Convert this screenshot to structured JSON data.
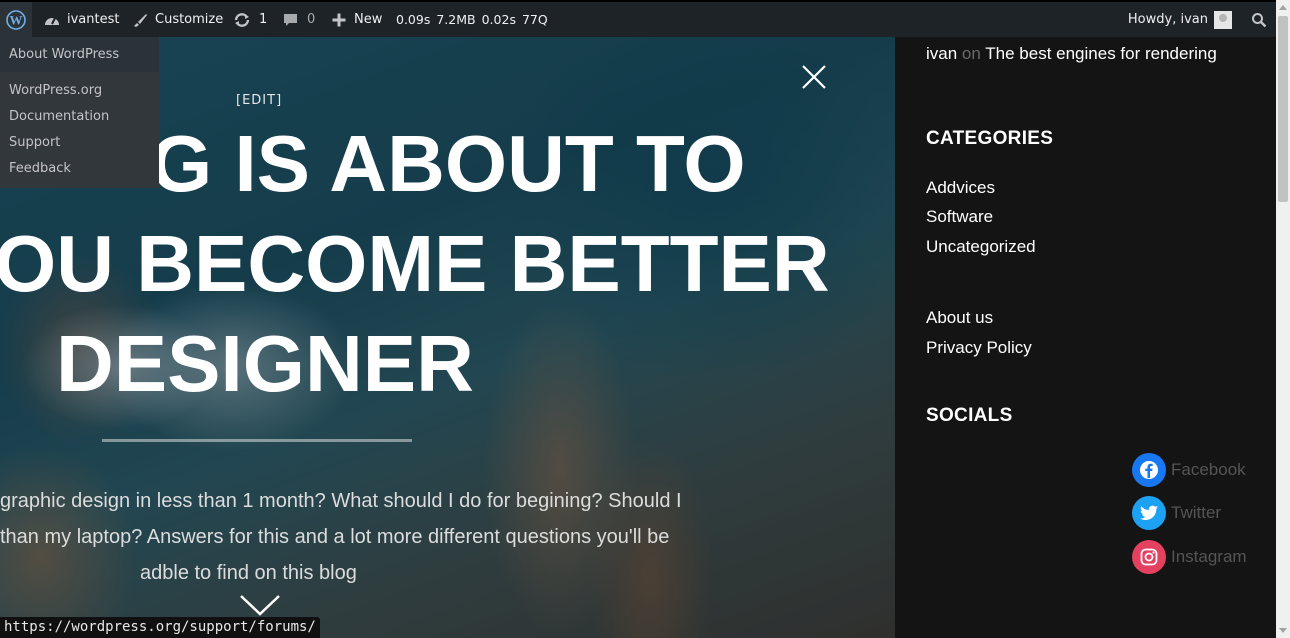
{
  "adminbar": {
    "site_name": "ivantest",
    "customize": "Customize",
    "updates_count": "1",
    "comments_count": "0",
    "new_label": "New",
    "perf_time": "0.09s",
    "perf_memory": "7.2MB",
    "perf_query_time": "0.02s",
    "perf_queries": "77Q",
    "howdy": "Howdy, ivan"
  },
  "wp_menu": {
    "about": "About WordPress",
    "items": [
      "WordPress.org",
      "Documentation",
      "Support",
      "Feedback"
    ]
  },
  "hero": {
    "edit_label": "[EDIT]",
    "headline": [
      "G IS ABOUT TO",
      "OU BECOME BETTER",
      "DESIGNER"
    ],
    "description": [
      "graphic design in less than 1 month? What should I do for begining? Should I",
      "than my laptop? Answers for this and a lot more different questions you'll be",
      "adble to find on this blog"
    ]
  },
  "status_url": "https://wordpress.org/support/forums/",
  "sidebar": {
    "recent_comment": {
      "author": "ivan",
      "on": "on",
      "post": "The best engines for rendering"
    },
    "categories_heading": "CATEGORIES",
    "categories": [
      "Addvices",
      "Software",
      "Uncategorized"
    ],
    "pages": [
      "About us",
      "Privacy Policy"
    ],
    "socials_heading": "SOCIALS",
    "socials": [
      {
        "label": "Facebook",
        "color": "#1877f2",
        "icon": "facebook-icon"
      },
      {
        "label": "Twitter",
        "color": "#1da1f2",
        "icon": "twitter-icon"
      },
      {
        "label": "Instagram",
        "color": "#e4405f",
        "icon": "instagram-icon"
      }
    ]
  }
}
